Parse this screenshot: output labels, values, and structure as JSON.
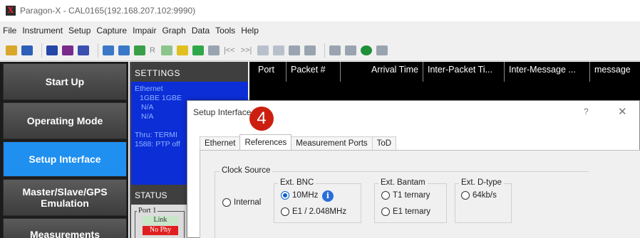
{
  "window": {
    "title": "Paragon-X - CAL0165(192.168.207.102:9990)",
    "logo": "X"
  },
  "menu": [
    "File",
    "Instrument",
    "Setup",
    "Capture",
    "Impair",
    "Graph",
    "Data",
    "Tools",
    "Help"
  ],
  "toolbar": {
    "r_label": "R",
    "nav_prev": "|<<",
    "nav_next": ">>|"
  },
  "nav": [
    {
      "label": "Start Up",
      "active": false
    },
    {
      "label": "Operating Mode",
      "active": false
    },
    {
      "label": "Setup Interface",
      "active": true
    },
    {
      "label": "Master/Slave/GPS Emulation",
      "active": false
    },
    {
      "label": "Measurements",
      "active": false
    }
  ],
  "settings": {
    "header": "SETTINGS",
    "lines": [
      "Ethernet",
      "1GBE  1GBE",
      "N/A",
      "N/A",
      "",
      "Thru: TERMI",
      "1588: PTP off"
    ]
  },
  "status": {
    "header": "STATUS",
    "port": "Port 1",
    "link": "Link",
    "no_phy": "No Phy"
  },
  "capture": {
    "columns": [
      "Port",
      "Packet #",
      "Arrival Time",
      "Inter-Packet Ti...",
      "Inter-Message ...",
      "message"
    ]
  },
  "dialog": {
    "title": "Setup Interface",
    "help": "?",
    "close": "✕",
    "step_badge": "4",
    "tabs": [
      {
        "label": "Ethernet",
        "active": false
      },
      {
        "label": "References",
        "active": true
      },
      {
        "label": "Measurement Ports",
        "active": false
      },
      {
        "label": "ToD",
        "active": false
      }
    ],
    "clock_source": {
      "label": "Clock Source",
      "internal": "Internal",
      "ext_bnc": {
        "label": "Ext. BNC",
        "opt1": "10MHz",
        "opt2": "E1 / 2.048MHz"
      },
      "ext_bantam": {
        "label": "Ext. Bantam",
        "opt1": "T1 ternary",
        "opt2": "E1 ternary"
      },
      "ext_dtype": {
        "label": "Ext. D-type",
        "opt1": "64kb/s"
      },
      "selected": "10MHz"
    }
  },
  "colors": {
    "nav_active": "#1f8ff0",
    "settings_bg": "#0c2ed6",
    "badge": "#cc1f10",
    "radio_selected": "#0a62d0"
  }
}
